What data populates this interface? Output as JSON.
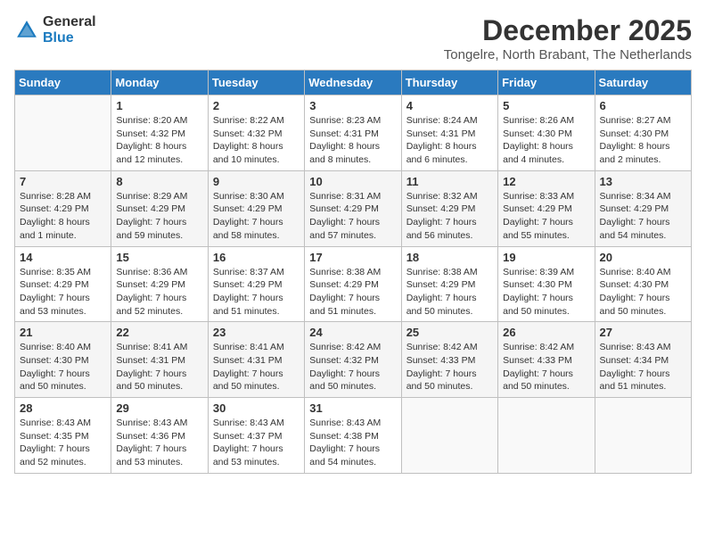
{
  "header": {
    "logo_general": "General",
    "logo_blue": "Blue",
    "month_year": "December 2025",
    "location": "Tongelre, North Brabant, The Netherlands"
  },
  "weekdays": [
    "Sunday",
    "Monday",
    "Tuesday",
    "Wednesday",
    "Thursday",
    "Friday",
    "Saturday"
  ],
  "weeks": [
    [
      {
        "day": "",
        "sunrise": "",
        "sunset": "",
        "daylight": ""
      },
      {
        "day": "1",
        "sunrise": "Sunrise: 8:20 AM",
        "sunset": "Sunset: 4:32 PM",
        "daylight": "Daylight: 8 hours and 12 minutes."
      },
      {
        "day": "2",
        "sunrise": "Sunrise: 8:22 AM",
        "sunset": "Sunset: 4:32 PM",
        "daylight": "Daylight: 8 hours and 10 minutes."
      },
      {
        "day": "3",
        "sunrise": "Sunrise: 8:23 AM",
        "sunset": "Sunset: 4:31 PM",
        "daylight": "Daylight: 8 hours and 8 minutes."
      },
      {
        "day": "4",
        "sunrise": "Sunrise: 8:24 AM",
        "sunset": "Sunset: 4:31 PM",
        "daylight": "Daylight: 8 hours and 6 minutes."
      },
      {
        "day": "5",
        "sunrise": "Sunrise: 8:26 AM",
        "sunset": "Sunset: 4:30 PM",
        "daylight": "Daylight: 8 hours and 4 minutes."
      },
      {
        "day": "6",
        "sunrise": "Sunrise: 8:27 AM",
        "sunset": "Sunset: 4:30 PM",
        "daylight": "Daylight: 8 hours and 2 minutes."
      }
    ],
    [
      {
        "day": "7",
        "sunrise": "Sunrise: 8:28 AM",
        "sunset": "Sunset: 4:29 PM",
        "daylight": "Daylight: 8 hours and 1 minute."
      },
      {
        "day": "8",
        "sunrise": "Sunrise: 8:29 AM",
        "sunset": "Sunset: 4:29 PM",
        "daylight": "Daylight: 7 hours and 59 minutes."
      },
      {
        "day": "9",
        "sunrise": "Sunrise: 8:30 AM",
        "sunset": "Sunset: 4:29 PM",
        "daylight": "Daylight: 7 hours and 58 minutes."
      },
      {
        "day": "10",
        "sunrise": "Sunrise: 8:31 AM",
        "sunset": "Sunset: 4:29 PM",
        "daylight": "Daylight: 7 hours and 57 minutes."
      },
      {
        "day": "11",
        "sunrise": "Sunrise: 8:32 AM",
        "sunset": "Sunset: 4:29 PM",
        "daylight": "Daylight: 7 hours and 56 minutes."
      },
      {
        "day": "12",
        "sunrise": "Sunrise: 8:33 AM",
        "sunset": "Sunset: 4:29 PM",
        "daylight": "Daylight: 7 hours and 55 minutes."
      },
      {
        "day": "13",
        "sunrise": "Sunrise: 8:34 AM",
        "sunset": "Sunset: 4:29 PM",
        "daylight": "Daylight: 7 hours and 54 minutes."
      }
    ],
    [
      {
        "day": "14",
        "sunrise": "Sunrise: 8:35 AM",
        "sunset": "Sunset: 4:29 PM",
        "daylight": "Daylight: 7 hours and 53 minutes."
      },
      {
        "day": "15",
        "sunrise": "Sunrise: 8:36 AM",
        "sunset": "Sunset: 4:29 PM",
        "daylight": "Daylight: 7 hours and 52 minutes."
      },
      {
        "day": "16",
        "sunrise": "Sunrise: 8:37 AM",
        "sunset": "Sunset: 4:29 PM",
        "daylight": "Daylight: 7 hours and 51 minutes."
      },
      {
        "day": "17",
        "sunrise": "Sunrise: 8:38 AM",
        "sunset": "Sunset: 4:29 PM",
        "daylight": "Daylight: 7 hours and 51 minutes."
      },
      {
        "day": "18",
        "sunrise": "Sunrise: 8:38 AM",
        "sunset": "Sunset: 4:29 PM",
        "daylight": "Daylight: 7 hours and 50 minutes."
      },
      {
        "day": "19",
        "sunrise": "Sunrise: 8:39 AM",
        "sunset": "Sunset: 4:30 PM",
        "daylight": "Daylight: 7 hours and 50 minutes."
      },
      {
        "day": "20",
        "sunrise": "Sunrise: 8:40 AM",
        "sunset": "Sunset: 4:30 PM",
        "daylight": "Daylight: 7 hours and 50 minutes."
      }
    ],
    [
      {
        "day": "21",
        "sunrise": "Sunrise: 8:40 AM",
        "sunset": "Sunset: 4:30 PM",
        "daylight": "Daylight: 7 hours and 50 minutes."
      },
      {
        "day": "22",
        "sunrise": "Sunrise: 8:41 AM",
        "sunset": "Sunset: 4:31 PM",
        "daylight": "Daylight: 7 hours and 50 minutes."
      },
      {
        "day": "23",
        "sunrise": "Sunrise: 8:41 AM",
        "sunset": "Sunset: 4:31 PM",
        "daylight": "Daylight: 7 hours and 50 minutes."
      },
      {
        "day": "24",
        "sunrise": "Sunrise: 8:42 AM",
        "sunset": "Sunset: 4:32 PM",
        "daylight": "Daylight: 7 hours and 50 minutes."
      },
      {
        "day": "25",
        "sunrise": "Sunrise: 8:42 AM",
        "sunset": "Sunset: 4:33 PM",
        "daylight": "Daylight: 7 hours and 50 minutes."
      },
      {
        "day": "26",
        "sunrise": "Sunrise: 8:42 AM",
        "sunset": "Sunset: 4:33 PM",
        "daylight": "Daylight: 7 hours and 50 minutes."
      },
      {
        "day": "27",
        "sunrise": "Sunrise: 8:43 AM",
        "sunset": "Sunset: 4:34 PM",
        "daylight": "Daylight: 7 hours and 51 minutes."
      }
    ],
    [
      {
        "day": "28",
        "sunrise": "Sunrise: 8:43 AM",
        "sunset": "Sunset: 4:35 PM",
        "daylight": "Daylight: 7 hours and 52 minutes."
      },
      {
        "day": "29",
        "sunrise": "Sunrise: 8:43 AM",
        "sunset": "Sunset: 4:36 PM",
        "daylight": "Daylight: 7 hours and 53 minutes."
      },
      {
        "day": "30",
        "sunrise": "Sunrise: 8:43 AM",
        "sunset": "Sunset: 4:37 PM",
        "daylight": "Daylight: 7 hours and 53 minutes."
      },
      {
        "day": "31",
        "sunrise": "Sunrise: 8:43 AM",
        "sunset": "Sunset: 4:38 PM",
        "daylight": "Daylight: 7 hours and 54 minutes."
      },
      {
        "day": "",
        "sunrise": "",
        "sunset": "",
        "daylight": ""
      },
      {
        "day": "",
        "sunrise": "",
        "sunset": "",
        "daylight": ""
      },
      {
        "day": "",
        "sunrise": "",
        "sunset": "",
        "daylight": ""
      }
    ]
  ]
}
